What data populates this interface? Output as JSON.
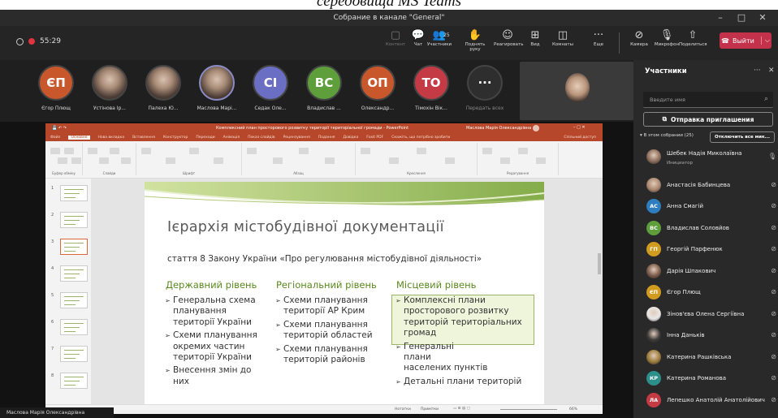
{
  "caption": "середовища MS Teams",
  "window": {
    "title": "Собрание в канале \"General\"",
    "minimize": "–",
    "maximize": "□",
    "close": "✕"
  },
  "call": {
    "timer": "55:29"
  },
  "toolbar": {
    "items": [
      {
        "label": "Контент",
        "icon": "▢",
        "dim": true
      },
      {
        "label": "Чат",
        "icon": "💬"
      },
      {
        "label": "Участники",
        "icon": "👥",
        "badge": "25"
      },
      {
        "label": "Поднять руку",
        "icon": "✋"
      },
      {
        "label": "Реагировать",
        "icon": "☺"
      },
      {
        "label": "Вид",
        "icon": "⊞"
      },
      {
        "label": "Комнаты",
        "icon": "◫"
      },
      {
        "label": "Еще",
        "icon": "···"
      },
      {
        "label": "Камера",
        "icon": "⊘"
      },
      {
        "label": "Микрофон",
        "icon": "🎙"
      },
      {
        "label": "Поделиться",
        "icon": "⇧"
      }
    ],
    "leave": "Выйти"
  },
  "participants_strip": [
    {
      "initials": "ЄП",
      "name": "Єгор Плющ",
      "color": "#c8572b"
    },
    {
      "initials": "",
      "name": "Устінова Ір...",
      "photo": true
    },
    {
      "initials": "",
      "name": "Палеха Ю...",
      "photo": true
    },
    {
      "initials": "",
      "name": "Маслова Марі...",
      "photo": true
    },
    {
      "initials": "СІ",
      "name": "Седак Оле...",
      "color": "#6b6fc4"
    },
    {
      "initials": "ВС",
      "name": "Владислав ...",
      "color": "#5e9e3b"
    },
    {
      "initials": "ОП",
      "name": "Олександр...",
      "color": "#c8572b"
    },
    {
      "initials": "ТО",
      "name": "Тімохін Вік...",
      "color": "#c43b45"
    },
    {
      "initials": "···",
      "name": "Передать всех",
      "color": "#2e2e2e"
    }
  ],
  "ppt": {
    "titlebar": "Комплексний план просторового розвитку території територіальної громади - PowerPoint",
    "user": "Маслова Марія Олександрівна",
    "tabs": [
      "Файл",
      "Основне",
      "Нова вкладка",
      "Вставлення",
      "Конструктор",
      "Переходи",
      "Анімація",
      "Показ слайдів",
      "Рецензування",
      "Подання",
      "Довідка",
      "Foxit PDF",
      "Скажіть, що потрібно зробити"
    ],
    "share": "Спільний доступ",
    "ribbon_groups": [
      "Буфер обміну",
      "Слайди",
      "Шрифт",
      "Абзац",
      "Креслення",
      "Редагування"
    ],
    "status_notes": "Нотатки",
    "status_comments": "Примітки",
    "zoom": "66%",
    "thumb_numbers": [
      "1",
      "2",
      "3",
      "4",
      "5",
      "6",
      "7",
      "8"
    ]
  },
  "slide": {
    "title": "Ієрархія містобудівної документації",
    "subtitle": "стаття 8 Закону України «Про регулювання містобудівної діяльності»",
    "columns": [
      {
        "heading": "Державний рівень",
        "items": [
          [
            "Генеральна схема",
            "планування",
            "території України"
          ],
          [
            "Схеми планування",
            "окремих частин",
            "території України"
          ],
          [
            "Внесення змін до",
            "них"
          ]
        ]
      },
      {
        "heading": "Регіональний рівень",
        "items": [
          [
            "Схеми планування",
            "території АР Крим"
          ],
          [
            "Схеми планування",
            "територій областей"
          ],
          [
            "Схеми планування",
            "територій районів"
          ]
        ]
      },
      {
        "heading": "Місцевий рівень",
        "items": [
          [
            "Комплексні плани",
            "просторового розвитку",
            "територій територіальних",
            "громад"
          ],
          [
            "Генеральні плани",
            "населених пунктів"
          ],
          [
            "Детальні плани територій"
          ]
        ]
      }
    ]
  },
  "panel": {
    "title": "Участники",
    "search_placeholder": "Введите имя",
    "invite": "Отправка приглашения",
    "section": "В этом собрании (25)",
    "mute_all": "Отключить все мик...",
    "people": [
      {
        "name": "Шебек Надія Миколаївна",
        "role": "Инициатор",
        "photo": true,
        "color": "#8a6d5a"
      },
      {
        "name": "Анастасія Бабинцева",
        "photo": true,
        "color": "#a8866e"
      },
      {
        "name": "Анна Смагій",
        "initials": "АС",
        "color": "#2d7dbf"
      },
      {
        "name": "Владислав Соловйов",
        "initials": "ВС",
        "color": "#5e9e3b"
      },
      {
        "name": "Георгій Парфенюк",
        "initials": "ГП",
        "color": "#d09b1e"
      },
      {
        "name": "Дарія Шпакович",
        "photo": true,
        "color": "#7a5a48"
      },
      {
        "name": "Єгор Плющ",
        "initials": "ЄП",
        "color": "#d09b1e"
      },
      {
        "name": "Зінов'єва Олена Сергіївна",
        "photo": true,
        "color": "#e8e8e8"
      },
      {
        "name": "Інна Данькiв",
        "photo": true,
        "color": "#3a3a3a"
      },
      {
        "name": "Катерина Рашківська",
        "photo": true,
        "color": "#9a7a3a"
      },
      {
        "name": "Катерина Романова",
        "initials": "КР",
        "color": "#2d8f8a"
      },
      {
        "name": "Лепешко Анатолій Анатолійович",
        "initials": "ЛА",
        "color": "#c43b45"
      }
    ]
  },
  "nametag": "Маслова Марія Олександрівна"
}
